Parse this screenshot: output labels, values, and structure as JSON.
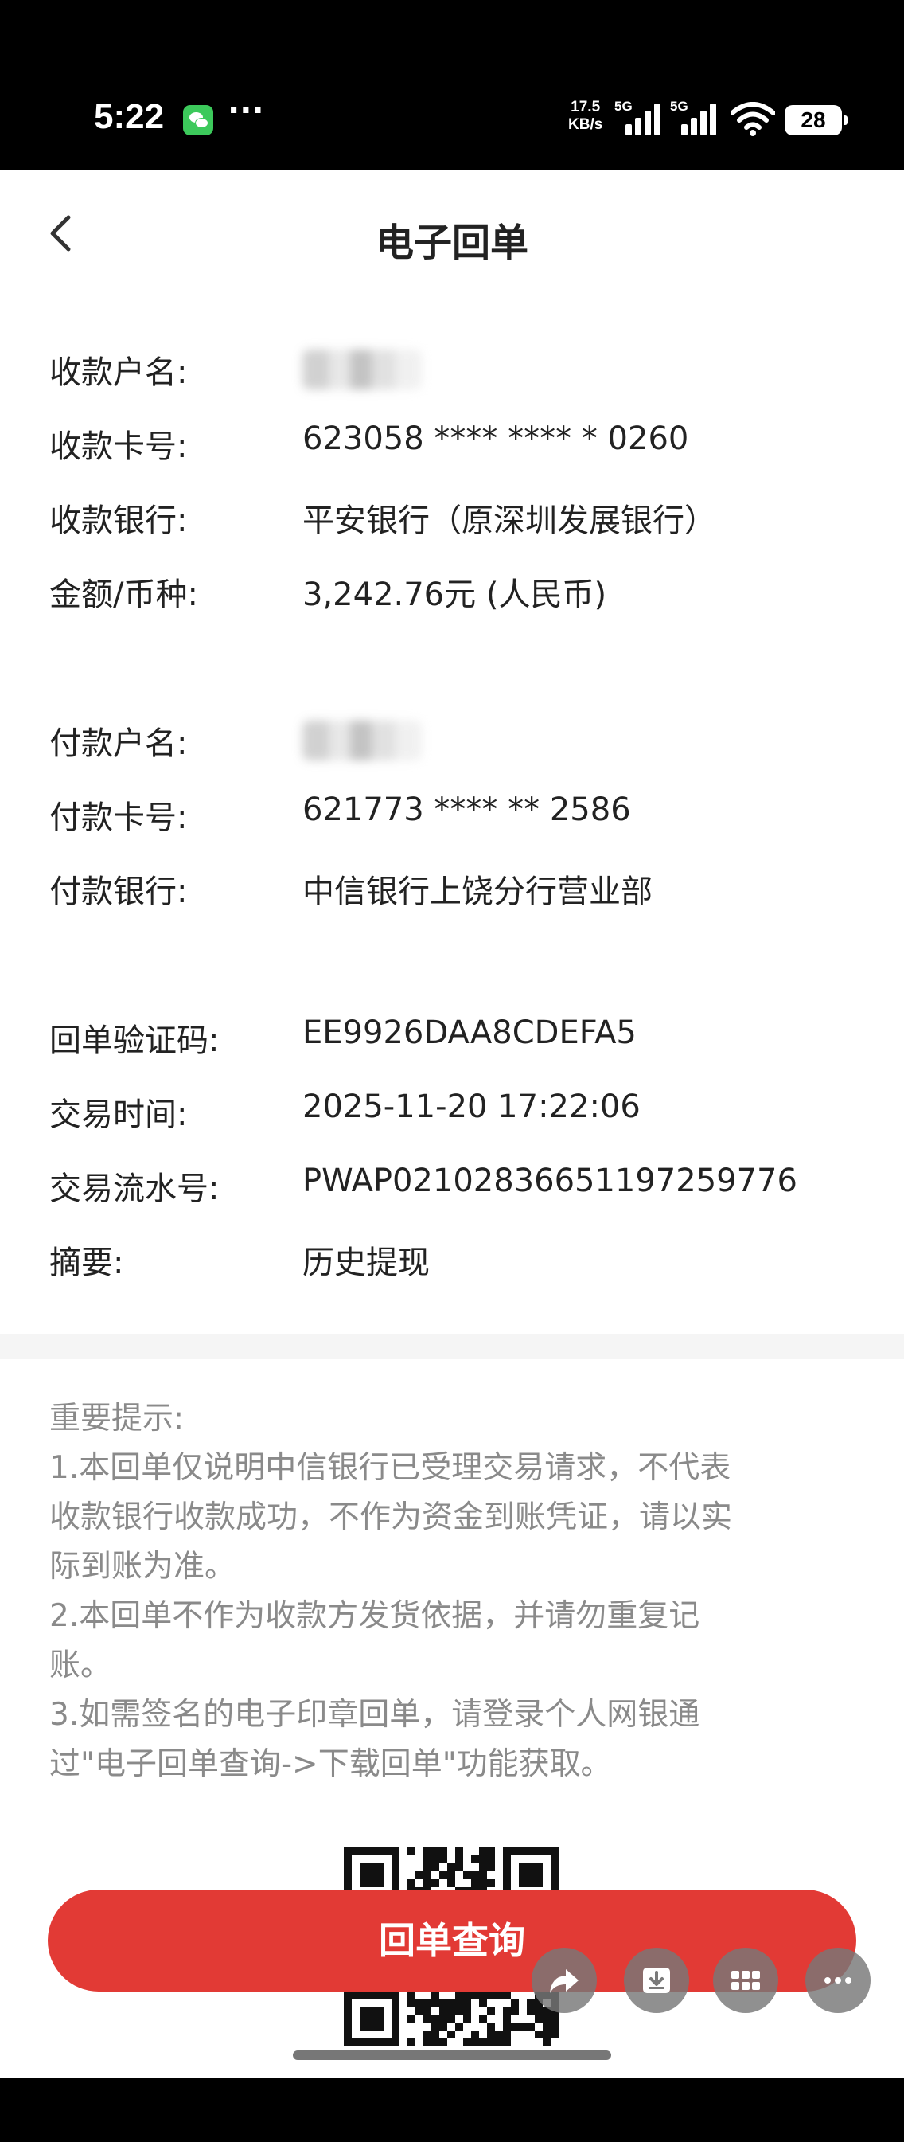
{
  "status_bar": {
    "time": "5:22",
    "more": "···",
    "net_speed_value": "17.5",
    "net_speed_unit": "KB/s",
    "sim1": "5G",
    "sim2": "5G",
    "battery": "28"
  },
  "nav": {
    "title": "电子回单"
  },
  "payee": {
    "name_label": "收款户名:",
    "card_label": "收款卡号:",
    "card_value": "623058 **** **** * 0260",
    "bank_label": "收款银行:",
    "bank_value": "平安银行（原深圳发展银行）",
    "amount_label": "金额/币种:",
    "amount_value": "3,242.76元 (人民币)"
  },
  "payer": {
    "name_label": "付款户名:",
    "card_label": "付款卡号:",
    "card_value": "621773 **** ** 2586",
    "bank_label": "付款银行:",
    "bank_value": "中信银行上饶分行营业部"
  },
  "details": {
    "code_label": "回单验证码:",
    "code_value": "EE9926DAA8CDEFA5",
    "time_label": "交易时间:",
    "time_value": "2025-11-20 17:22:06",
    "serial_label": "交易流水号:",
    "serial_value": "PWAP02102836651197259776",
    "summary_label": "摘要:",
    "summary_value": "历史提现"
  },
  "notice": {
    "title": "重要提示:",
    "line1": "1.本回单仅说明中信银行已受理交易请求，不代表",
    "line2": "收款银行收款成功，不作为资金到账凭证，请以实",
    "line3": "际到账为准。",
    "line4": "2.本回单不作为收款方发货依据，并请勿重复记",
    "line5": "账。",
    "line6": "3.如需签名的电子印章回单，请登录个人网银通",
    "line7": "过\"电子回单查询->下载回单\"功能获取。"
  },
  "query_button": "回单查询",
  "colors": {
    "accent": "#e23a35",
    "notice_text": "#8a8a8a"
  },
  "icons": [
    "back-icon",
    "wechat-icon",
    "wifi-icon",
    "share-icon",
    "download-icon",
    "grid-icon",
    "more-icon",
    "qr-code"
  ]
}
